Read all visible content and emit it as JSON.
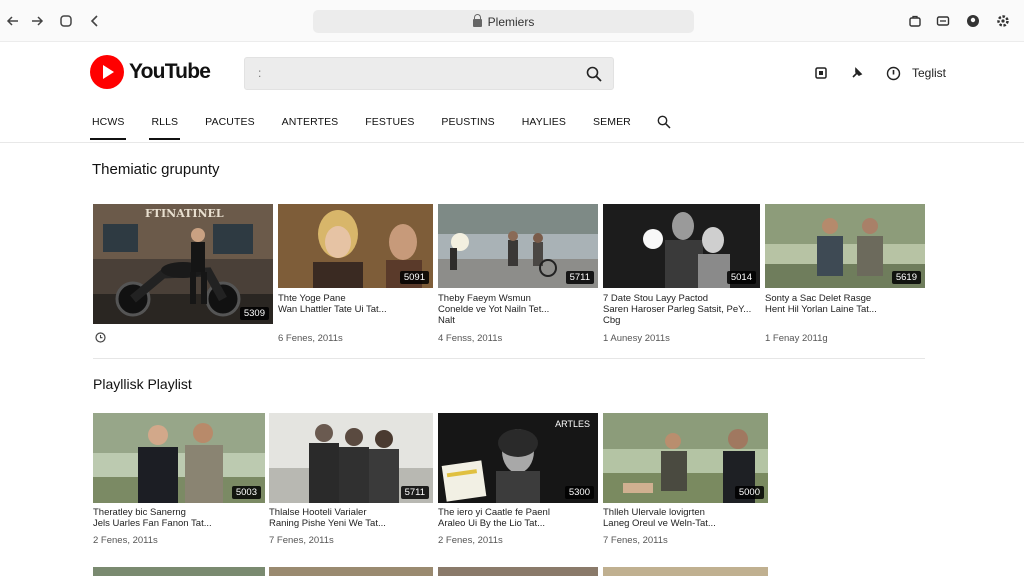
{
  "browser": {
    "address": "Plemiers",
    "icons": [
      "back-arrow-icon",
      "forward-arrow-icon",
      "home-icon",
      "reload-icon",
      "extension-icon",
      "cast-icon",
      "profile-icon",
      "settings-icon"
    ]
  },
  "header": {
    "logo_text": "YouTube",
    "search_caret": ":",
    "sign_in": "Teglist",
    "brand_color": "#ff0000"
  },
  "tabs": [
    {
      "label": "HCWS",
      "active": true
    },
    {
      "label": "RLLS",
      "active": true
    },
    {
      "label": "PACUTES",
      "active": false
    },
    {
      "label": "ANTERTES",
      "active": false
    },
    {
      "label": "FESTUES",
      "active": false
    },
    {
      "label": "PEUSTINS",
      "active": false
    },
    {
      "label": "HAYLIES",
      "active": false
    },
    {
      "label": "SEMER",
      "active": false
    }
  ],
  "sections": [
    {
      "title": "Themiatic grupunty",
      "cards": [
        {
          "duration": "5309",
          "line1": "",
          "line2": "",
          "meta": "",
          "thumb_label": "FTINATINEL"
        },
        {
          "duration": "5091",
          "line1": "Thte Yoge Pane",
          "line2": "Wan Lhattler Tate Ui Tat...",
          "line3": "",
          "meta": "6 Fenes, 2011s"
        },
        {
          "duration": "5711",
          "line1": "Theby Faeym Wsmun",
          "line2": "Conelde ve Yot Nailn Tet...",
          "line3": "Nalt",
          "meta": "4 Fenss, 2011s"
        },
        {
          "duration": "5014",
          "line1": "7 Date Stou Layy Pactod",
          "line2": "Saren Haroser Parleg Satsit, PeY...",
          "line3": "Cbg",
          "meta": "1 Aunesy 2011s"
        },
        {
          "duration": "5619",
          "line1": "Sonty a Sac Delet Rasge",
          "line2": "Hent Hil Yorlan Laine Tat...",
          "line3": "",
          "meta": "1 Fenay 2011g"
        }
      ]
    },
    {
      "title": "Playllisk Playlist",
      "cards": [
        {
          "duration": "5003",
          "line1": "Theratley bic Sanerng",
          "line2": "Jels Uarles Fan Fanon Tat...",
          "meta": "2 Fenes, 2011s"
        },
        {
          "duration": "5711",
          "line1": "Thlalse Hooteli Varialer",
          "line2": "Raning Pishe Yeni We Tat...",
          "meta": "7 Fenes, 2011s"
        },
        {
          "duration": "5300",
          "line1": "The iero yi Caatle fe Paenl",
          "line2": "Araleo Ui By the Lio Tat...",
          "meta": "2 Fenes, 2011s",
          "thumb_label": "ARTLES"
        },
        {
          "duration": "5000",
          "line1": "Thlleh Ulervale lovigrten",
          "line2": "Laneg Oreul ve Weln-Tat...",
          "meta": "7 Fenes, 2011s"
        }
      ]
    }
  ],
  "first_card_icon": "clock-icon"
}
